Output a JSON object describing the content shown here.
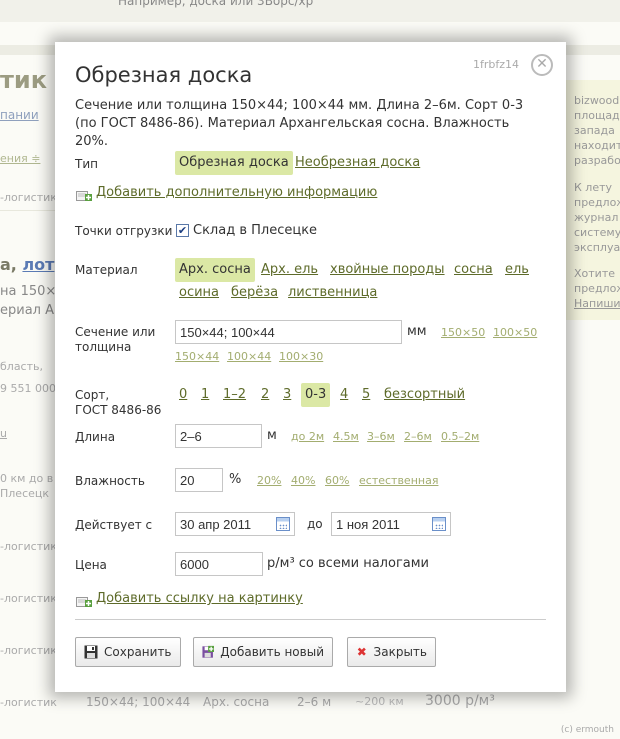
{
  "background": {
    "top_text": "Например, доска или 3Ворс/хр",
    "heading": "тик",
    "company_link": "пании",
    "sort_link": "ения ≑",
    "rows_label": "-логистик",
    "item_title_prefix": "а,",
    "item_title_link": "лот",
    "item_line1": "на 150×",
    "item_line2": "ериал А",
    "region": "бласть,",
    "phone": "9 551 000",
    "ru": "u",
    "distance": "0 км до в",
    "place": "Плесецк",
    "right_col": [
      "bizwood",
      "площад",
      "запада",
      "находит",
      "разрабо",
      "К лету",
      "предлож",
      "журнал",
      "систему",
      "эксплуа",
      "Хотите",
      "предлож",
      "Напиши"
    ],
    "last_row": {
      "section": "150×44; 100×44",
      "material": "Арх. сосна",
      "length": "2–6 м",
      "distance": "~200 км",
      "price": "3000 р/м³"
    },
    "credit": "(c) ermouth"
  },
  "modal": {
    "id": "1frbfz14",
    "close_label": "✕",
    "title": "Обрезная доска",
    "summary": "Сечение или толщина 150×44; 100×44 мм. Длина 2–6м. Сорт 0-3 (по ГОСТ 8486-86). Материал Архангельская сосна. Влажность 20%.",
    "type": {
      "label": "Тип",
      "options": [
        "Обрезная доска",
        "Необрезная доска"
      ],
      "selected": "Обрезная доска"
    },
    "add_info_link": "Добавить дополнительную информацию",
    "shipping": {
      "label": "Точки отгрузки",
      "checkbox_checked": true,
      "value": "Склад в Плесецке"
    },
    "material": {
      "label": "Материал",
      "options": [
        "Арх. сосна",
        "Арх. ель",
        "хвойные породы",
        "сосна",
        "ель",
        "осина",
        "берёза",
        "лиственница"
      ],
      "selected": "Арх. сосна"
    },
    "section": {
      "label_line1": "Сечение или",
      "label_line2": "толщина",
      "value": "150×44; 100×44",
      "unit": "мм",
      "suggestions": [
        "150×50",
        "100×50",
        "150×44",
        "100×44",
        "100×30"
      ]
    },
    "grade": {
      "label_line1": "Сорт,",
      "label_line2": "ГОСТ 8486-86",
      "options": [
        "0",
        "1",
        "1–2",
        "2",
        "3",
        "0-3",
        "4",
        "5",
        "безсортный"
      ],
      "selected": "0-3"
    },
    "length": {
      "label": "Длина",
      "value": "2–6",
      "unit": "м",
      "suggestions": [
        "до 2м",
        "4.5м",
        "3–6м",
        "2–6м",
        "0.5–2м"
      ]
    },
    "humidity": {
      "label": "Влажность",
      "value": "20",
      "unit": "%",
      "suggestions": [
        "20%",
        "40%",
        "60%",
        "естественная"
      ]
    },
    "valid": {
      "label": "Действует с",
      "from": "30 апр 2011",
      "to_label": "до",
      "to": "1 ноя 2011"
    },
    "price": {
      "label": "Цена",
      "value": "6000",
      "unit": "р/м³ со всеми налогами"
    },
    "add_picture_link": "Добавить ссылку на картинку",
    "buttons": {
      "save": "Сохранить",
      "add_new": "Добавить новый",
      "close": "Закрыть"
    }
  },
  "colors": {
    "selected_bg": "#dbe8a5",
    "link": "#5e6b2a",
    "suggestion": "#a3ad70"
  }
}
